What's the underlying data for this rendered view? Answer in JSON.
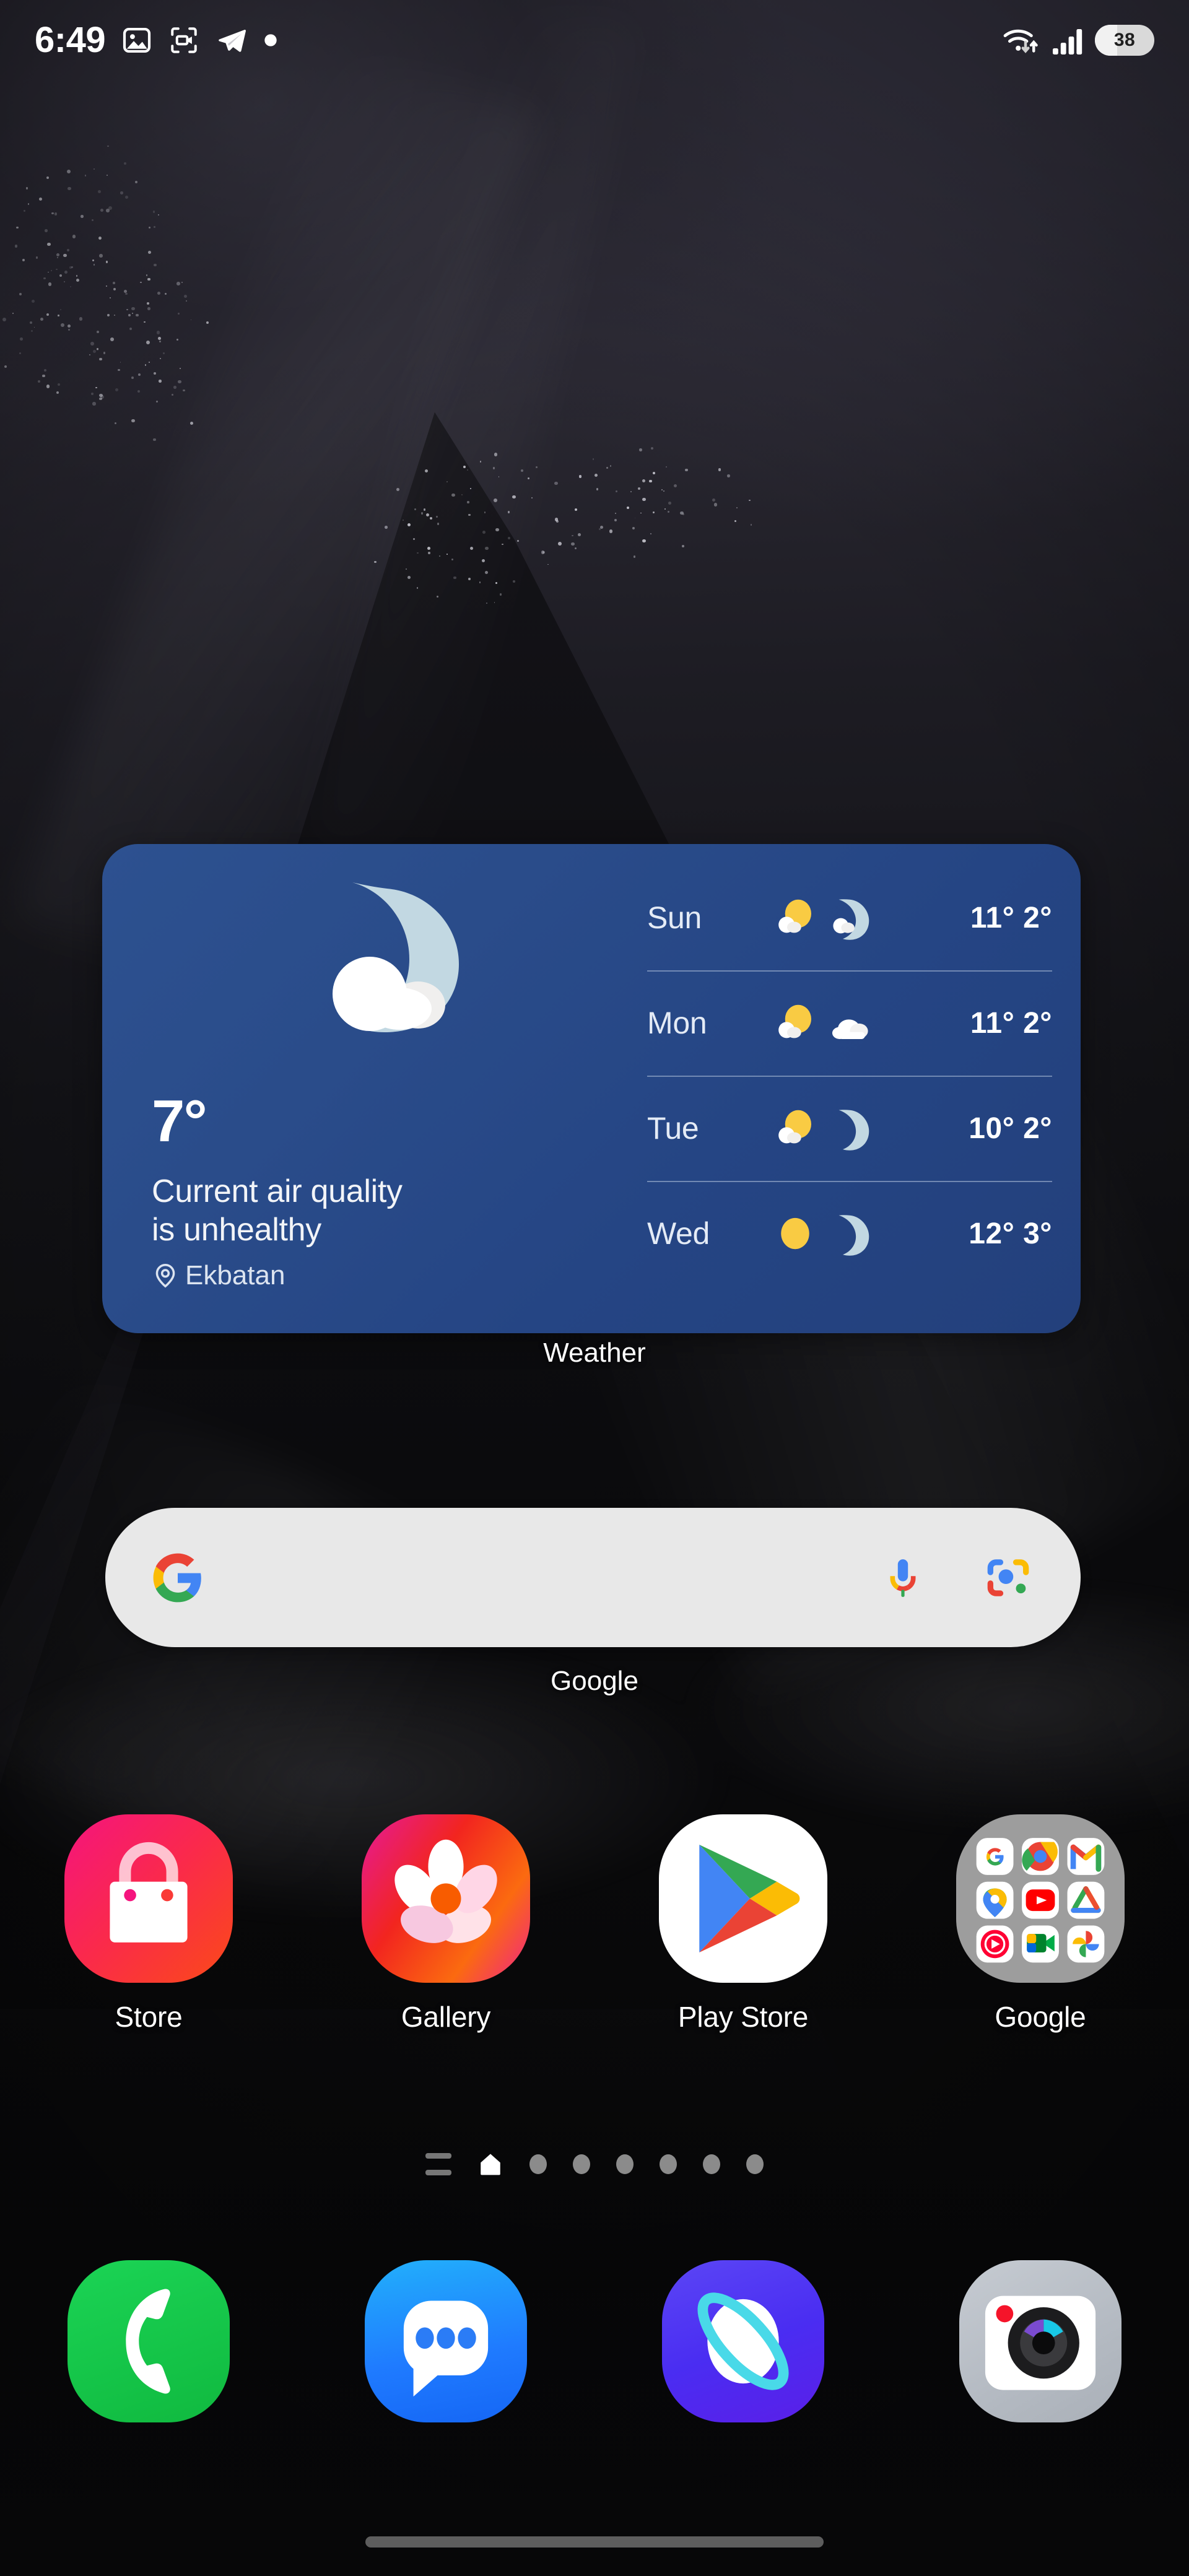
{
  "status_bar": {
    "clock": "6:49",
    "notification_icons": [
      "image-icon",
      "screen-record-icon",
      "telegram-icon",
      "dot-icon"
    ],
    "right_icons": [
      "wifi-icon",
      "cellular-signal-icon"
    ],
    "battery_level": "38",
    "battery_pill_bg": "#d9d9d9"
  },
  "weather_widget": {
    "label": "Weather",
    "current_temp": "7°",
    "air_quality_text": "Current air quality is unhealthy",
    "air_quality_line1": "Current air quality",
    "air_quality_line2": "is unhealthy",
    "location": "Ekbatan",
    "main_condition_icon": "moon-cloud-icon",
    "widget_bg": "#274a86",
    "forecast": [
      {
        "day": "Sun",
        "day_icon": "sun-cloud-icon",
        "night_icon": "moon-cloud-icon",
        "high": "11°",
        "low": "2°",
        "temps": "11° 2°"
      },
      {
        "day": "Mon",
        "day_icon": "sun-cloud-icon",
        "night_icon": "cloud-icon",
        "high": "11°",
        "low": "2°",
        "temps": "11° 2°"
      },
      {
        "day": "Tue",
        "day_icon": "sun-cloud-icon",
        "night_icon": "moon-icon",
        "high": "10°",
        "low": "2°",
        "temps": "10° 2°"
      },
      {
        "day": "Wed",
        "day_icon": "sun-icon",
        "night_icon": "moon-icon",
        "high": "12°",
        "low": "3°",
        "temps": "12° 3°"
      }
    ]
  },
  "search_widget": {
    "label": "Google",
    "query": "",
    "placeholder": "",
    "left_icon": "google-g-icon",
    "mic_icon": "microphone-icon",
    "lens_icon": "google-lens-icon",
    "pill_bg": "#e8e8e8"
  },
  "app_grid": [
    {
      "label": "Store",
      "icon": "shopping-bag-icon",
      "colors": [
        "#f5147e",
        "#fa3c1e"
      ]
    },
    {
      "label": "Gallery",
      "icon": "flower-icon",
      "colors": [
        "#a21ae0",
        "#f7431a"
      ]
    },
    {
      "label": "Play Store",
      "icon": "play-triangle-icon",
      "colors": [
        "#ffffff",
        "#ffffff"
      ]
    },
    {
      "label": "Google",
      "icon": "google-folder-icon",
      "colors": [
        "#9b9b9b",
        "#9b9b9b"
      ],
      "folder_apps": [
        "Google",
        "Chrome",
        "Gmail",
        "Maps",
        "YouTube",
        "Drive",
        "YouTube Music",
        "Meet",
        "Photos"
      ]
    }
  ],
  "page_indicator": {
    "items": [
      "app-list-icon",
      "home-icon",
      "page-dot",
      "page-dot",
      "page-dot",
      "page-dot",
      "page-dot",
      "page-dot"
    ],
    "current_page": 1,
    "total_pages": 7
  },
  "dock": [
    {
      "label": "Phone",
      "icon": "phone-handset-icon",
      "color": "#16c44d"
    },
    {
      "label": "Messages",
      "icon": "message-bubble-icon",
      "color": "#1f7bff"
    },
    {
      "label": "Internet",
      "icon": "planet-orbit-icon",
      "color": "#4b37f0"
    },
    {
      "label": "Camera",
      "icon": "camera-icon",
      "color": "#b9bec6"
    }
  ],
  "nav_bar": {
    "gesture_pill": "home-gesture-pill"
  }
}
